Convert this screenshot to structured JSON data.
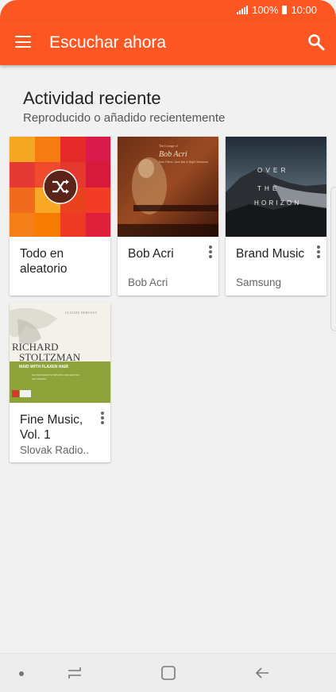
{
  "status_bar": {
    "battery": "100%",
    "time": "10:00"
  },
  "app_bar": {
    "title": "Escuchar ahora"
  },
  "section": {
    "title": "Actividad reciente",
    "subtitle": "Reproducido o añadido recientemente"
  },
  "cards": [
    {
      "title": "Todo en aleatorio",
      "subtitle": ""
    },
    {
      "title": "Bob Acri",
      "subtitle": "Bob Acri"
    },
    {
      "title": "Brand Music",
      "subtitle": "Samsung"
    },
    {
      "title": "Fine Music, Vol. 1",
      "subtitle": "Slovak Radio.."
    }
  ],
  "album_art": {
    "bob_acri": {
      "line1": "The Lounge of",
      "line2": "Bob Acri",
      "line3": "Solo Piano, Jazz Bar & Night Sessions"
    },
    "brand_music": {
      "word1": "O V E R",
      "word2": "T H E",
      "word3": "H O R I Z O N"
    },
    "fine_music": {
      "composer": "CLAUDE DEBUSSY",
      "artist_line1": "RICHARD",
      "artist_line2": "STOLTZMAN",
      "track": "MAID WITH FLAXEN HAIR",
      "orchestra": "SLOVAK RADIO SYMPHONY ORCHESTRA",
      "conductor": "JAN TRENDL"
    }
  },
  "colors": {
    "accent": "#fc5722",
    "background": "#f1f1f1"
  },
  "icons": [
    "menu-icon",
    "search-icon",
    "shuffle-icon",
    "more-vert-icon",
    "recent-apps-icon",
    "home-icon",
    "back-icon"
  ]
}
